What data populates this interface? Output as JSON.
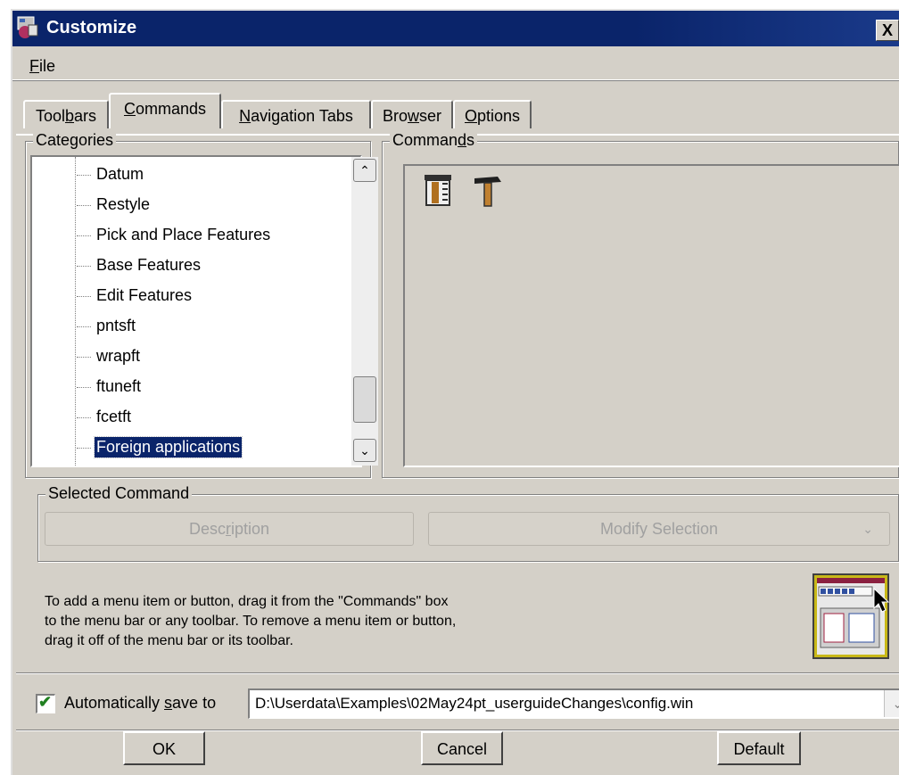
{
  "window": {
    "title": "Customize",
    "close_glyph": "X"
  },
  "menu": {
    "file": {
      "prefix": "",
      "accel": "F",
      "rest": "ile"
    }
  },
  "tabs": [
    {
      "prefix": "Tool",
      "accel": "b",
      "rest": "ars",
      "active": false
    },
    {
      "prefix": "",
      "accel": "C",
      "rest": "ommands",
      "active": true
    },
    {
      "prefix": "",
      "accel": "N",
      "rest": "avigation Tabs",
      "active": false
    },
    {
      "prefix": "Bro",
      "accel": "w",
      "rest": "ser",
      "active": false
    },
    {
      "prefix": "",
      "accel": "O",
      "rest": "ptions",
      "active": false
    }
  ],
  "categories": {
    "legend_prefix": "Cate",
    "legend_accel": "g",
    "legend_rest": "ories",
    "items": [
      "Datum",
      "Restyle",
      "Pick and Place Features",
      "Base Features",
      "Edit Features",
      "pntsft",
      "wrapft",
      "ftuneft",
      "fcetft",
      "Foreign applications"
    ],
    "selected_index": 9
  },
  "commands": {
    "legend_prefix": "Comman",
    "legend_accel": "d",
    "legend_rest": "s",
    "icons": [
      "column-hammer-icon",
      "hammer-icon"
    ]
  },
  "selected_command": {
    "legend": "Selected Command",
    "description_prefix": "Desc",
    "description_accel": "r",
    "description_rest": "iption",
    "modify_label": "Modify Selection",
    "modify_arrow": "⌄"
  },
  "help_text": {
    "line1": "To add a menu item or button, drag it from the \"Commands\" box",
    "line2": "to the menu bar or any toolbar.  To remove a menu item or button,",
    "line3": "drag it off of the menu bar or its toolbar."
  },
  "autosave": {
    "checked": true,
    "check_glyph": "✔",
    "label_prefix": "Automatically ",
    "label_accel": "s",
    "label_rest": "ave to",
    "path": "D:\\Userdata\\Examples\\02May24pt_userguideChanges\\config.win",
    "arrow": "⌄"
  },
  "buttons": {
    "ok": "OK",
    "cancel": "Cancel",
    "default": "Default"
  },
  "scroll": {
    "up_glyph": "⌃",
    "down_glyph": "⌄"
  },
  "colors": {
    "titlebar": "#0a246a",
    "dialog_bg": "#d4d0c8",
    "selection": "#0a246a"
  }
}
